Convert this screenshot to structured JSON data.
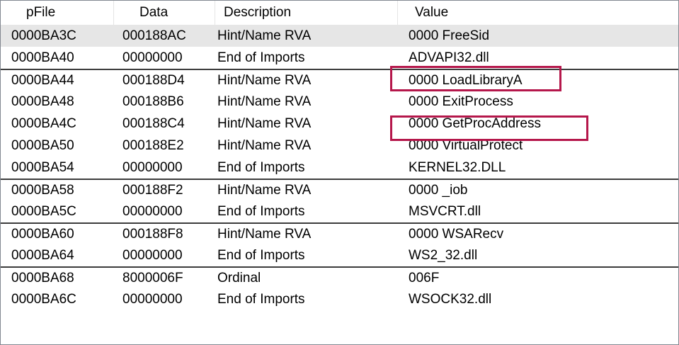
{
  "columns": {
    "pfile": "pFile",
    "data": "Data",
    "description": "Description",
    "value": "Value"
  },
  "colors": {
    "highlight_box": "#b5174b",
    "selected_row": "#e6e6e6",
    "group_separator": "#3c3c3c"
  },
  "rows": [
    {
      "pfile": "0000BA3C",
      "data": "000188AC",
      "description": "Hint/Name RVA",
      "value": "0000  FreeSid",
      "selected": true,
      "group_start": false,
      "highlighted": false
    },
    {
      "pfile": "0000BA40",
      "data": "00000000",
      "description": "End of Imports",
      "value": "ADVAPI32.dll",
      "selected": false,
      "group_start": false,
      "highlighted": false
    },
    {
      "pfile": "0000BA44",
      "data": "000188D4",
      "description": "Hint/Name RVA",
      "value": "0000  LoadLibraryA",
      "selected": false,
      "group_start": true,
      "highlighted": true
    },
    {
      "pfile": "0000BA48",
      "data": "000188B6",
      "description": "Hint/Name RVA",
      "value": "0000  ExitProcess",
      "selected": false,
      "group_start": false,
      "highlighted": false
    },
    {
      "pfile": "0000BA4C",
      "data": "000188C4",
      "description": "Hint/Name RVA",
      "value": "0000  GetProcAddress",
      "selected": false,
      "group_start": false,
      "highlighted": true
    },
    {
      "pfile": "0000BA50",
      "data": "000188E2",
      "description": "Hint/Name RVA",
      "value": "0000  VirtualProtect",
      "selected": false,
      "group_start": false,
      "highlighted": false
    },
    {
      "pfile": "0000BA54",
      "data": "00000000",
      "description": "End of Imports",
      "value": "KERNEL32.DLL",
      "selected": false,
      "group_start": false,
      "highlighted": false
    },
    {
      "pfile": "0000BA58",
      "data": "000188F2",
      "description": "Hint/Name RVA",
      "value": "0000  _iob",
      "selected": false,
      "group_start": true,
      "highlighted": false
    },
    {
      "pfile": "0000BA5C",
      "data": "00000000",
      "description": "End of Imports",
      "value": "MSVCRT.dll",
      "selected": false,
      "group_start": false,
      "highlighted": false
    },
    {
      "pfile": "0000BA60",
      "data": "000188F8",
      "description": "Hint/Name RVA",
      "value": "0000  WSARecv",
      "selected": false,
      "group_start": true,
      "highlighted": false
    },
    {
      "pfile": "0000BA64",
      "data": "00000000",
      "description": "End of Imports",
      "value": "WS2_32.dll",
      "selected": false,
      "group_start": false,
      "highlighted": false
    },
    {
      "pfile": "0000BA68",
      "data": "8000006F",
      "description": "Ordinal",
      "value": "006F",
      "selected": false,
      "group_start": true,
      "highlighted": false
    },
    {
      "pfile": "0000BA6C",
      "data": "00000000",
      "description": "End of Imports",
      "value": "WSOCK32.dll",
      "selected": false,
      "group_start": false,
      "highlighted": false
    }
  ]
}
